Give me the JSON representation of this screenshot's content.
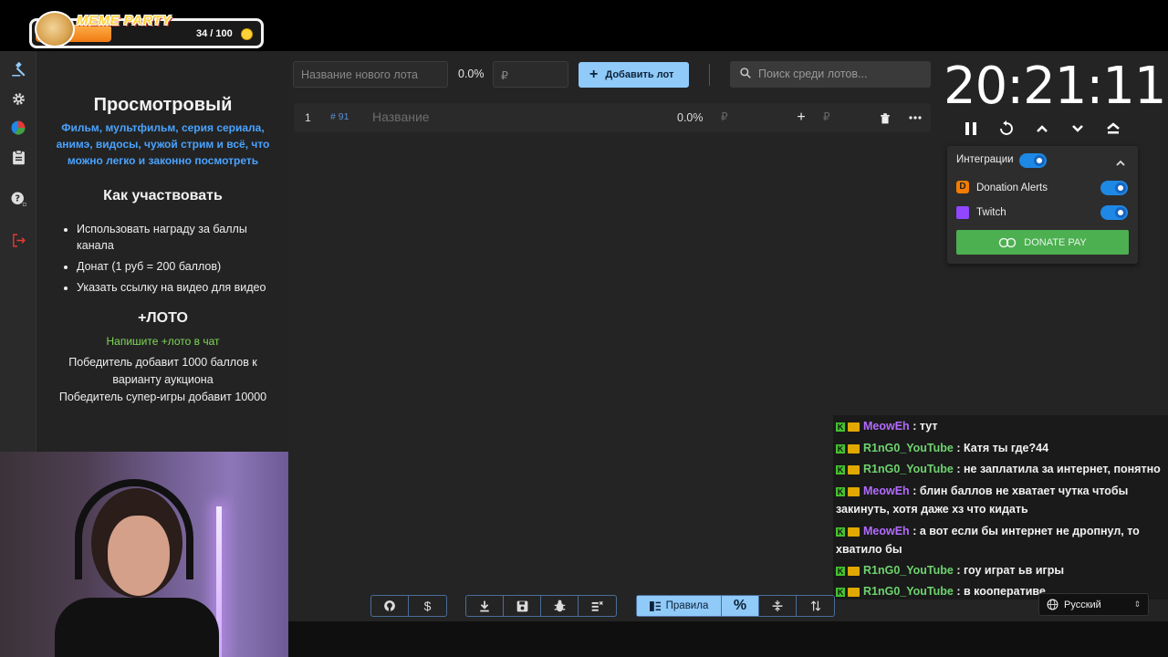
{
  "overlay": {
    "brand": "MEME PARTY",
    "counter": "34 / 100",
    "progress": 0.34
  },
  "info": {
    "title": "Просмотровый",
    "description": "Фильм, мультфильм, серия сериала, анимэ, видосы, чужой стрим и всё, что можно легко и законно посмотреть",
    "how_title": "Как участвовать",
    "how_items": [
      "Использовать награду за баллы канала",
      "Донат (1 руб = 200 баллов)",
      "Указать ссылку на видео для видео"
    ],
    "loto_title": "+ЛОТО",
    "loto_hint": "Напишите +лото в чат",
    "loto_text_1": "Победитель добавит 1000 баллов к варианту аукциона",
    "loto_text_2": "Победитель супер-игры добавит 10000"
  },
  "toolbar": {
    "new_lot_placeholder": "Название нового лота",
    "percent": "0.0%",
    "amount_placeholder": "₽",
    "add_button": "Добавить лот",
    "search_placeholder": "Поиск среди лотов..."
  },
  "lots": [
    {
      "index": "1",
      "id": "# 91",
      "name_placeholder": "Название",
      "percent": "0.0%",
      "currency": "₽",
      "add_currency": "₽"
    }
  ],
  "timer": {
    "value": "20:21:11"
  },
  "integrations": {
    "title": "Интеграции",
    "items": [
      {
        "label": "Donation Alerts",
        "enabled": true
      },
      {
        "label": "Twitch",
        "enabled": true
      }
    ],
    "donate_button": "DONATE PAY"
  },
  "chat": [
    {
      "user": "MeowEh",
      "color": "purple",
      "text": ": тут"
    },
    {
      "user": "R1nG0_YouTube",
      "color": "green",
      "text": ": Катя ты где?44"
    },
    {
      "user": "R1nG0_YouTube",
      "color": "green",
      "text": ": не заплатила за интернет, понятно"
    },
    {
      "user": "MeowEh",
      "color": "purple",
      "text": ": блин баллов не хватает чутка чтобы закинуть, хотя даже хз что кидать"
    },
    {
      "user": "MeowEh",
      "color": "purple",
      "text": ": а вот если бы интернет не дропнул, то хватило бы"
    },
    {
      "user": "R1nG0_YouTube",
      "color": "green",
      "text": ": гоу играт ьв игры"
    },
    {
      "user": "R1nG0_YouTube",
      "color": "green",
      "text": ": в кооперативе"
    }
  ],
  "bottom": {
    "rules_label": "Правила"
  },
  "language": {
    "selected": "Русский"
  },
  "colors": {
    "accent": "#90caf9",
    "toggle": "#1e88e5",
    "donate_green": "#4caf50",
    "link_blue": "#4aa3ff",
    "loto_green": "#7ed957"
  }
}
